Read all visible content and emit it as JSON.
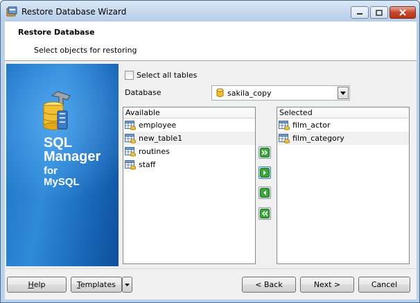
{
  "window": {
    "title": "Restore Database Wizard",
    "controls": [
      "minimize",
      "maximize",
      "close"
    ]
  },
  "header": {
    "title": "Restore Database",
    "subtitle": "Select objects for restoring"
  },
  "banner": {
    "line1": "SQL",
    "line2": "Manager",
    "line3": "for",
    "line4": "MySQL",
    "logo_icon": "sql-manager-logo-icon"
  },
  "options": {
    "select_all_label": "Select all tables",
    "select_all_checked": false,
    "database_label": "Database",
    "database_value": "sakila_copy"
  },
  "available": {
    "header": "Available",
    "items": [
      "employee",
      "new_table1",
      "routines",
      "staff"
    ],
    "highlighted_index": 1
  },
  "selected": {
    "header": "Selected",
    "items": [
      "film_actor",
      "film_category"
    ],
    "highlighted_index": 1
  },
  "transfer_buttons": [
    {
      "icon": "move-all-right-icon"
    },
    {
      "icon": "move-right-icon"
    },
    {
      "icon": "move-left-icon"
    },
    {
      "icon": "move-all-left-icon"
    }
  ],
  "footer": {
    "help": "Help",
    "templates": "Templates",
    "back": "< Back",
    "next": "Next >",
    "cancel": "Cancel"
  },
  "colors": {
    "banner_blue": "#1c73c4",
    "arrow_green": "#2e9a2e"
  }
}
